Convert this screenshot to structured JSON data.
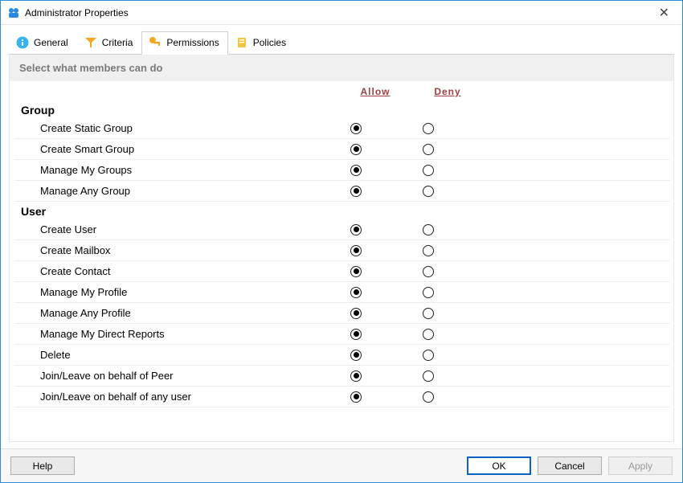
{
  "window": {
    "title": "Administrator Properties"
  },
  "tabs": [
    {
      "label": "General"
    },
    {
      "label": "Criteria"
    },
    {
      "label": "Permissions"
    },
    {
      "label": "Policies"
    }
  ],
  "instruction": "Select what members can do",
  "columns": {
    "allow": "Allow",
    "deny": "Deny"
  },
  "sections": [
    {
      "title": "Group",
      "rows": [
        {
          "label": "Create Static Group",
          "selected": "allow"
        },
        {
          "label": "Create Smart Group",
          "selected": "allow"
        },
        {
          "label": "Manage My Groups",
          "selected": "allow"
        },
        {
          "label": "Manage Any Group",
          "selected": "allow"
        }
      ]
    },
    {
      "title": "User",
      "rows": [
        {
          "label": "Create User",
          "selected": "allow"
        },
        {
          "label": "Create Mailbox",
          "selected": "allow"
        },
        {
          "label": "Create Contact",
          "selected": "allow"
        },
        {
          "label": "Manage My Profile",
          "selected": "allow"
        },
        {
          "label": "Manage Any Profile",
          "selected": "allow"
        },
        {
          "label": "Manage My Direct Reports",
          "selected": "allow"
        },
        {
          "label": "Delete",
          "selected": "allow"
        },
        {
          "label": "Join/Leave on behalf of Peer",
          "selected": "allow"
        },
        {
          "label": "Join/Leave on behalf of any user",
          "selected": "allow"
        }
      ]
    }
  ],
  "buttons": {
    "help": "Help",
    "ok": "OK",
    "cancel": "Cancel",
    "apply": "Apply"
  }
}
